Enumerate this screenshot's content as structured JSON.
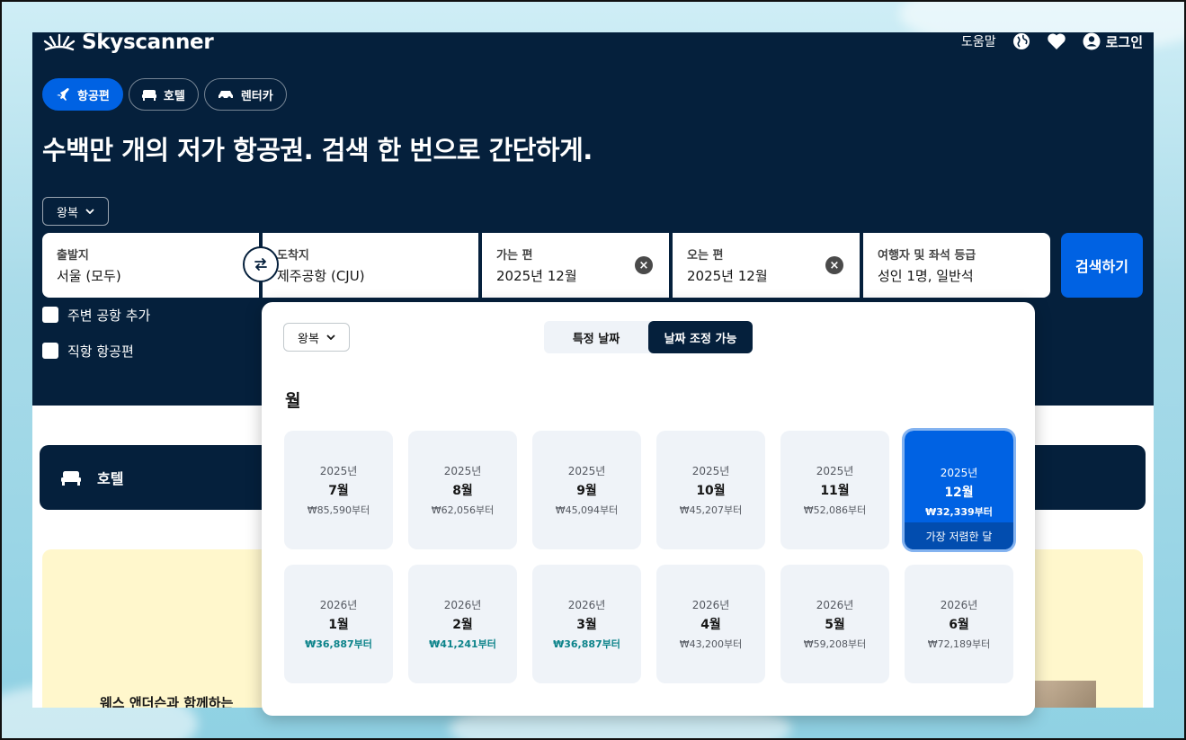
{
  "brand": {
    "name": "Skyscanner"
  },
  "header": {
    "help_label": "도움말",
    "login_label": "로그인"
  },
  "tabs": [
    {
      "label": "항공편",
      "icon": "plane-icon",
      "active": true
    },
    {
      "label": "호텔",
      "icon": "bed-icon",
      "active": false
    },
    {
      "label": "렌터카",
      "icon": "car-icon",
      "active": false
    }
  ],
  "hero": {
    "headline": "수백만 개의 저가 항공권. 검색 한 번으로 간단하게.",
    "trip_type": "왕복"
  },
  "search": {
    "origin": {
      "label": "출발지",
      "value": "서울 (모두)"
    },
    "destination": {
      "label": "도착지",
      "value": "제주공항 (CJU)"
    },
    "depart": {
      "label": "가는 편",
      "value": "2025년 12월"
    },
    "return": {
      "label": "오는 편",
      "value": "2025년 12월"
    },
    "travelers": {
      "label": "여행자 및 좌석 등급",
      "value": "성인 1명, 일반석"
    },
    "button_label": "검색하기"
  },
  "options": {
    "nearby_airports": "주변 공항 추가",
    "direct_flights": "직항 항공편"
  },
  "hotel_banner": {
    "label": "호텔"
  },
  "promo": {
    "text": "웨스 앤더슨과 함께하는"
  },
  "date_popup": {
    "trip_type": "왕복",
    "toggle": {
      "specific": "특정 날짜",
      "flexible": "날짜 조정 가능",
      "active": "flexible"
    },
    "section_title": "월",
    "months": [
      {
        "year": "2025년",
        "month": "7월",
        "price": "₩85,590부터",
        "cheap": false,
        "selected": false
      },
      {
        "year": "2025년",
        "month": "8월",
        "price": "₩62,056부터",
        "cheap": false,
        "selected": false
      },
      {
        "year": "2025년",
        "month": "9월",
        "price": "₩45,094부터",
        "cheap": false,
        "selected": false
      },
      {
        "year": "2025년",
        "month": "10월",
        "price": "₩45,207부터",
        "cheap": false,
        "selected": false
      },
      {
        "year": "2025년",
        "month": "11월",
        "price": "₩52,086부터",
        "cheap": false,
        "selected": false
      },
      {
        "year": "2025년",
        "month": "12월",
        "price": "₩32,339부터",
        "cheap": false,
        "selected": true,
        "tag": "가장 저렴한 달"
      },
      {
        "year": "2026년",
        "month": "1월",
        "price": "₩36,887부터",
        "cheap": true,
        "selected": false
      },
      {
        "year": "2026년",
        "month": "2월",
        "price": "₩41,241부터",
        "cheap": true,
        "selected": false
      },
      {
        "year": "2026년",
        "month": "3월",
        "price": "₩36,887부터",
        "cheap": true,
        "selected": false
      },
      {
        "year": "2026년",
        "month": "4월",
        "price": "₩43,200부터",
        "cheap": false,
        "selected": false
      },
      {
        "year": "2026년",
        "month": "5월",
        "price": "₩59,208부터",
        "cheap": false,
        "selected": false
      },
      {
        "year": "2026년",
        "month": "6월",
        "price": "₩72,189부터",
        "cheap": false,
        "selected": false
      }
    ]
  },
  "colors": {
    "navy": "#05203c",
    "primary": "#0062e3",
    "cheap_price": "#0c838a"
  }
}
